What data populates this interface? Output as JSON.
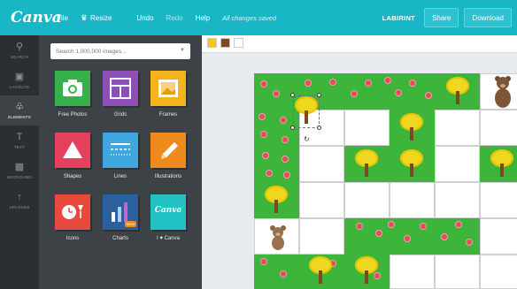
{
  "app": {
    "logo": "Canva",
    "menu": [
      "File",
      "Resize",
      "Undo",
      "Redo",
      "Help"
    ],
    "saved_status": "All changes saved",
    "document_name": "LABIRINT",
    "share_label": "Share",
    "download_label": "Download"
  },
  "rail": [
    {
      "label": "SEARCH",
      "icon": "magnifier-icon"
    },
    {
      "label": "LAYOUTS",
      "icon": "layouts-icon"
    },
    {
      "label": "ELEMENTS",
      "icon": "shapes-icon"
    },
    {
      "label": "TEXT",
      "icon": "text-icon"
    },
    {
      "label": "BKGROUND",
      "icon": "background-icon"
    },
    {
      "label": "UPLOADS",
      "icon": "upload-icon"
    }
  ],
  "panel": {
    "search_placeholder": "Search 1,000,000 images...",
    "tiles": [
      {
        "label": "Free Photos",
        "color": "#35b24d",
        "icon": "camera-icon"
      },
      {
        "label": "Grids",
        "color": "#8f4fb8",
        "icon": "grid-icon"
      },
      {
        "label": "Frames",
        "color": "#f2b31c",
        "icon": "frame-icon"
      },
      {
        "label": "Shapes",
        "color": "#e5405e",
        "icon": "triangle-icon"
      },
      {
        "label": "Lines",
        "color": "#3fa6e0",
        "icon": "lines-icon"
      },
      {
        "label": "Illustrations",
        "color": "#f08a1d",
        "icon": "pencil-icon"
      },
      {
        "label": "Icons",
        "color": "#e74a3c",
        "icon": "clock-icon"
      },
      {
        "label": "Charts",
        "color": "#2b5f9e",
        "icon": "chart-icon",
        "badge": "NEW"
      },
      {
        "label": "I ♥ Canva",
        "color": "#22c1c3",
        "icon": "canva-logo-icon",
        "logo_text": "Canva"
      }
    ]
  },
  "palette": {
    "colors": [
      "#f5c518",
      "#7a4a22",
      "#ffffff"
    ]
  },
  "colors": {
    "topbar": "#19b7c5",
    "grass": "#3db43a",
    "flower": "#e8485a",
    "tree_crown": "#f0d820"
  }
}
